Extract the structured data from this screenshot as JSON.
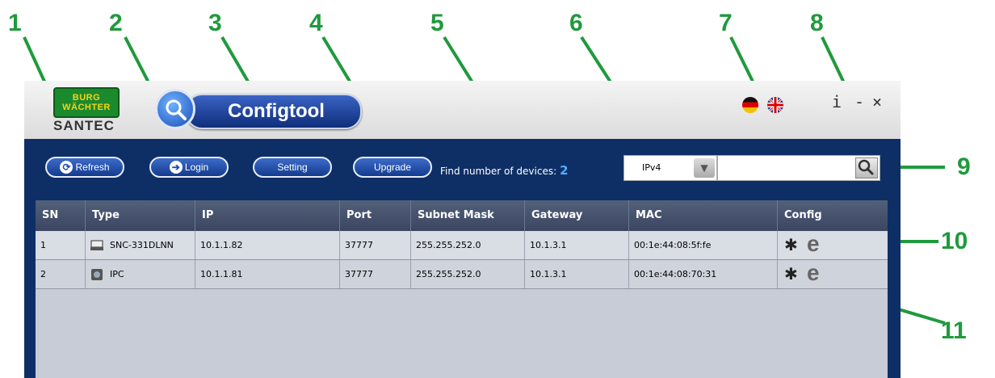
{
  "callouts": [
    "1",
    "2",
    "3",
    "4",
    "5",
    "6",
    "7",
    "8",
    "9",
    "10",
    "11"
  ],
  "logo": {
    "badge_line1": "BURG",
    "badge_line2": "WÄCHTER",
    "subtitle": "SANTEC"
  },
  "app": {
    "title": "Configtool"
  },
  "window_controls": {
    "info": "i",
    "minimize": "-",
    "close": "×"
  },
  "toolbar": {
    "refresh_label": "Refresh",
    "login_label": "Login",
    "setting_label": "Setting",
    "upgrade_label": "Upgrade",
    "found_label": "Find number of devices:",
    "found_count": "2",
    "ip_version": "IPv4",
    "search_value": ""
  },
  "table": {
    "columns": [
      "SN",
      "Type",
      "IP",
      "Port",
      "Subnet Mask",
      "Gateway",
      "MAC",
      "Config"
    ],
    "rows": [
      {
        "sn": "1",
        "type": "SNC-331DLNN",
        "icon": "nvr-device-icon",
        "ip": "10.1.1.82",
        "port": "37777",
        "mask": "255.255.252.0",
        "gateway": "10.1.3.1",
        "mac": "00:1e:44:08:5f:fe"
      },
      {
        "sn": "2",
        "type": "IPC",
        "icon": "camera-device-icon",
        "ip": "10.1.1.81",
        "port": "37777",
        "mask": "255.255.252.0",
        "gateway": "10.1.3.1",
        "mac": "00:1e:44:08:70:31"
      }
    ]
  },
  "colors": {
    "callout": "#1f9a3c",
    "window_bg": "#0e2f66",
    "button": "#1d4fb0",
    "count": "#4fb0ff"
  }
}
